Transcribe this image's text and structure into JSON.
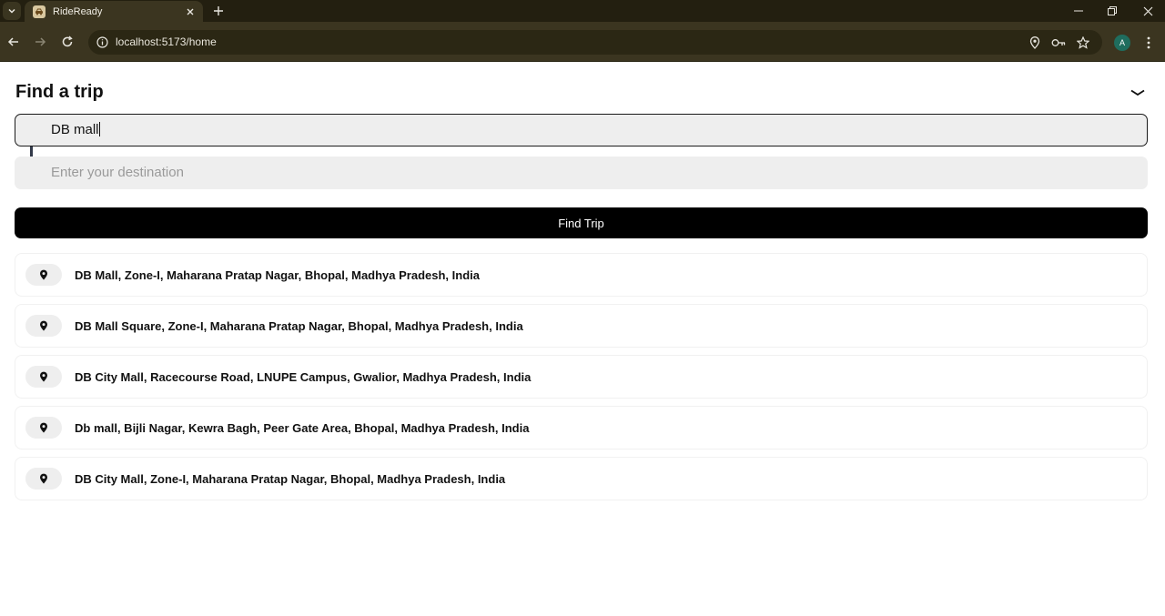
{
  "browser": {
    "tab_title": "RideReady",
    "url": "localhost:5173/home",
    "profile_initial": "A"
  },
  "page": {
    "title": "Find a trip",
    "pickup_value": "DB mall",
    "destination_placeholder": "Enter your destination",
    "find_button_label": "Find Trip",
    "suggestions": [
      "DB Mall, Zone-I, Maharana Pratap Nagar, Bhopal, Madhya Pradesh, India",
      "DB Mall Square, Zone-I, Maharana Pratap Nagar, Bhopal, Madhya Pradesh, India",
      "DB City Mall, Racecourse Road, LNUPE Campus, Gwalior, Madhya Pradesh, India",
      "Db mall, Bijli Nagar, Kewra Bagh, Peer Gate Area, Bhopal, Madhya Pradesh, India",
      "DB City Mall, Zone-I, Maharana Pratap Nagar, Bhopal, Madhya Pradesh, India"
    ]
  },
  "colors": {
    "chrome_dark": "#231f10",
    "chrome_toolbar": "#3b3520",
    "input_bg": "#eeeeee",
    "button_bg": "#000000",
    "connector": "#333a4a"
  }
}
